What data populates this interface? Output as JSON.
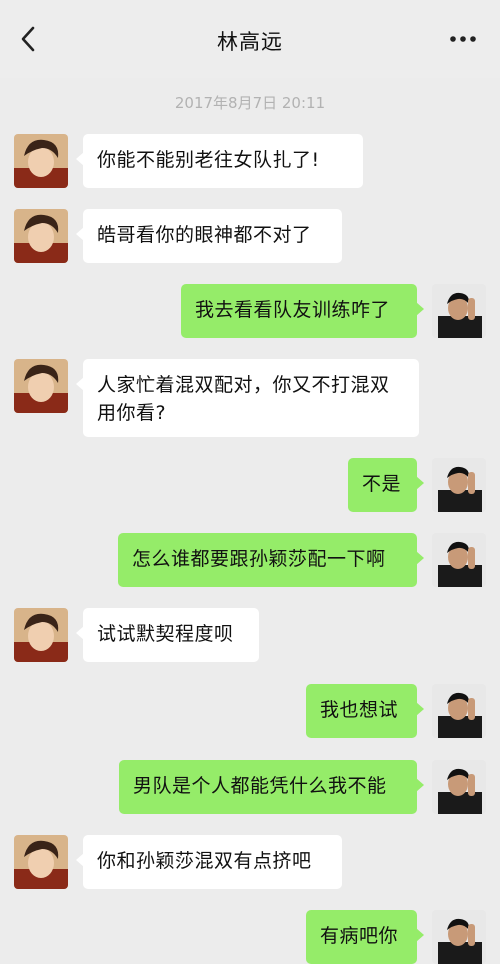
{
  "header": {
    "title": "林高远",
    "back_icon": "chevron-left-icon",
    "more_icon": "more-dots-icon"
  },
  "timestamp": "2017年8月7日 20:11",
  "colors": {
    "background": "#ececec",
    "incoming_bubble": "#ffffff",
    "outgoing_bubble": "#95ec69"
  },
  "messages": [
    {
      "side": "left",
      "text": "你能不能别老往女队扎了!"
    },
    {
      "side": "left",
      "text": "皓哥看你的眼神都不对了"
    },
    {
      "side": "right",
      "text": "我去看看队友训练咋了"
    },
    {
      "side": "left",
      "text": "人家忙着混双配对，你又不打混双用你看?"
    },
    {
      "side": "right",
      "text": "不是"
    },
    {
      "side": "right",
      "text": "怎么谁都要跟孙颖莎配一下啊"
    },
    {
      "side": "left",
      "text": "试试默契程度呗"
    },
    {
      "side": "right",
      "text": "我也想试"
    },
    {
      "side": "right",
      "text": "男队是个人都能凭什么我不能"
    },
    {
      "side": "left",
      "text": "你和孙颖莎混双有点挤吧"
    },
    {
      "side": "right",
      "text": "有病吧你"
    }
  ]
}
